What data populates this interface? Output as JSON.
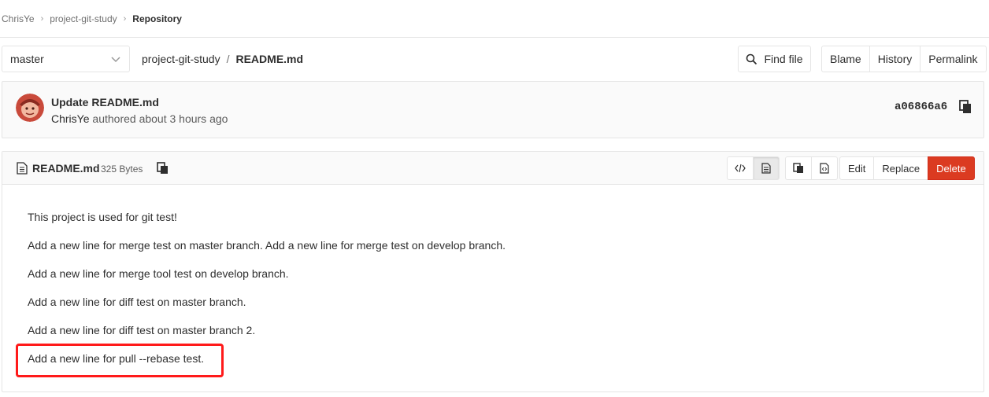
{
  "breadcrumbs": {
    "items": [
      "ChrisYe",
      "project-git-study",
      "Repository"
    ]
  },
  "tree": {
    "branch": "master",
    "project": "project-git-study",
    "path_separator": "/",
    "file": "README.md",
    "find_file_label": "Find file",
    "actions": [
      "Blame",
      "History",
      "Permalink"
    ]
  },
  "commit": {
    "title": "Update README.md",
    "author": "ChrisYe",
    "authored_text": "authored about 3 hours ago",
    "sha": "a06866a6"
  },
  "file": {
    "name": "README.md",
    "size": "325 Bytes",
    "edit_label": "Edit",
    "replace_label": "Replace",
    "delete_label": "Delete",
    "lines": [
      "This project is used for git test!",
      "Add a new line for merge test on master branch. Add a new line for merge test on develop branch.",
      "Add a new line for merge tool test on develop branch.",
      "Add a new line for diff test on master branch.",
      "Add a new line for diff test on master branch 2.",
      "Add a new line for pull --rebase test."
    ]
  },
  "colors": {
    "danger": "#db3b21",
    "highlight": "#ff1a1a",
    "border": "#e5e5e5"
  }
}
